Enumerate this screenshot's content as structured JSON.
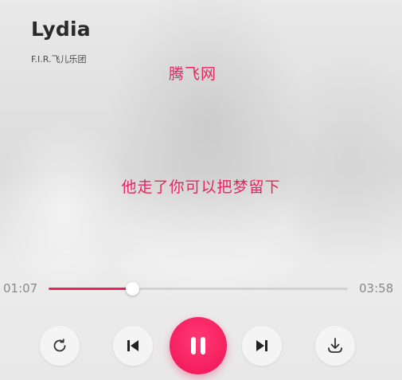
{
  "song": {
    "title": "Lydia",
    "artist": "F.I.R.飞儿乐团"
  },
  "watermark": "腾飞网",
  "lyrics": {
    "current_line": "他走了你可以把梦留下"
  },
  "player": {
    "current_time": "01:07",
    "total_time": "03:58",
    "progress_fraction": 0.28,
    "is_playing": true,
    "accent_color": "#e8245e"
  },
  "controls": {
    "repeat_icon": "repeat-icon",
    "previous_icon": "previous-track-icon",
    "pause_icon": "pause-icon",
    "next_icon": "next-track-icon",
    "download_icon": "download-icon"
  }
}
